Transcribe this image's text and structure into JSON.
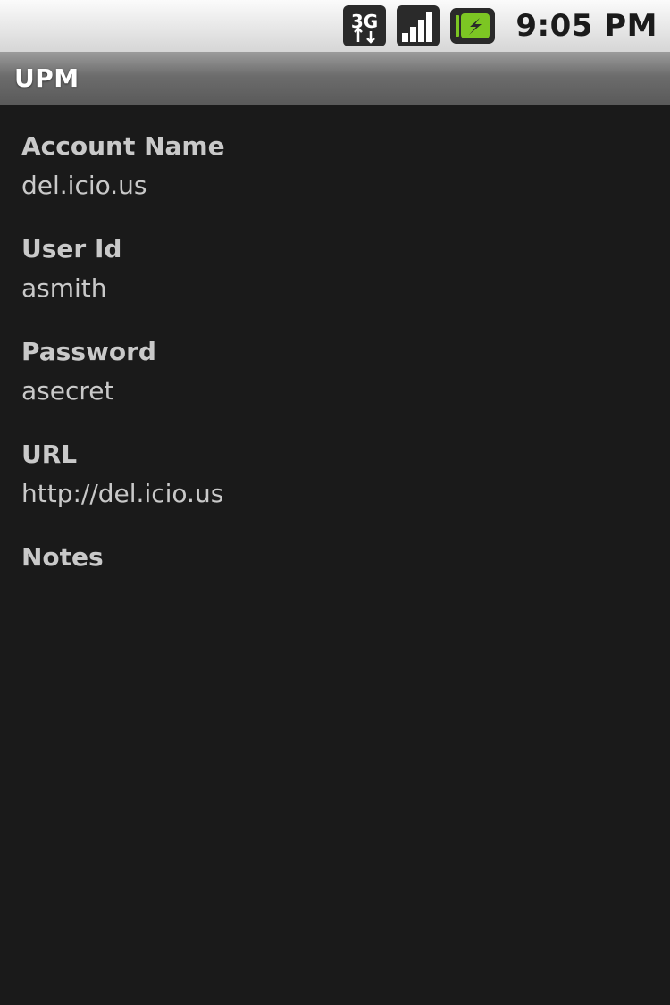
{
  "status_bar": {
    "network_type": "3G",
    "network_icon": "3g-data-icon",
    "signal_icon": "signal-strength-icon",
    "battery_icon": "battery-charging-icon",
    "time": "9:05 PM"
  },
  "title_bar": {
    "title": "UPM"
  },
  "account": {
    "fields": [
      {
        "label": "Account Name",
        "value": "del.icio.us"
      },
      {
        "label": "User Id",
        "value": "asmith"
      },
      {
        "label": "Password",
        "value": "asecret"
      },
      {
        "label": "URL",
        "value": "http://del.icio.us"
      },
      {
        "label": "Notes",
        "value": ""
      }
    ]
  },
  "colors": {
    "background": "#1a1a1a",
    "text": "#c9c9c9",
    "battery_green": "#7cc623"
  }
}
